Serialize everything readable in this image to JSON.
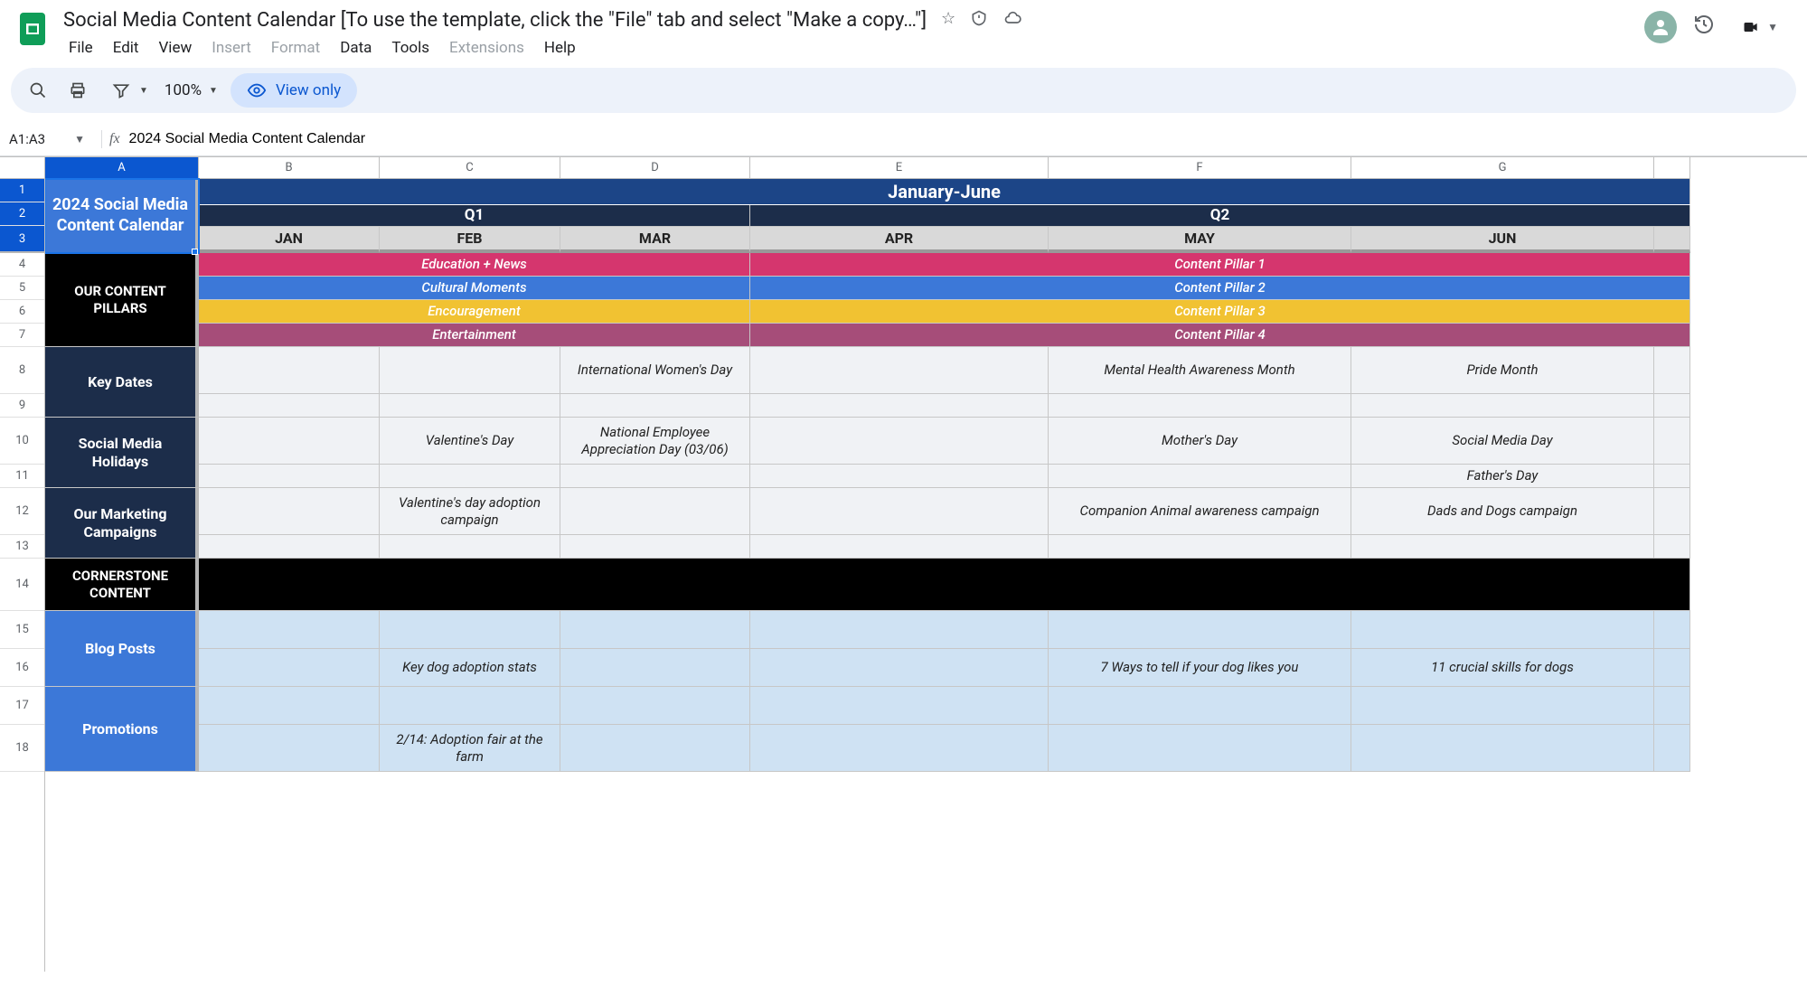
{
  "header": {
    "doc_title": "Social Media Content Calendar [To use the template, click the \"File\" tab and select \"Make a copy…\"]"
  },
  "menubar": {
    "file": "File",
    "edit": "Edit",
    "view": "View",
    "insert": "Insert",
    "format": "Format",
    "data": "Data",
    "tools": "Tools",
    "extensions": "Extensions",
    "help": "Help"
  },
  "toolbar": {
    "zoom": "100%",
    "view_only": "View only"
  },
  "formula": {
    "name_box": "A1:A3",
    "value": "2024 Social Media Content Calendar"
  },
  "columns": [
    "A",
    "B",
    "C",
    "D",
    "E",
    "F",
    "G"
  ],
  "rows": [
    "1",
    "2",
    "3",
    "4",
    "5",
    "6",
    "7",
    "8",
    "9",
    "10",
    "11",
    "12",
    "13",
    "14",
    "15",
    "16",
    "17",
    "18"
  ],
  "sheet": {
    "title": "2024 Social Media Content Calendar",
    "period": "January-June",
    "q1": "Q1",
    "q2": "Q2",
    "months": {
      "jan": "JAN",
      "feb": "FEB",
      "mar": "MAR",
      "apr": "APR",
      "may": "MAY",
      "jun": "JUN"
    },
    "side": {
      "pillars": "OUR CONTENT PILLARS",
      "keydates": "Key Dates",
      "holidays": "Social Media Holidays",
      "campaigns": "Our Marketing Campaigns",
      "cornerstone": "CORNERSTONE CONTENT",
      "blog": "Blog Posts",
      "promotions": "Promotions"
    },
    "pillars_q1": {
      "p1": "Education + News",
      "p2": "Cultural Moments",
      "p3": "Encouragement",
      "p4": "Entertainment"
    },
    "pillars_q2": {
      "p1": "Content Pillar 1",
      "p2": "Content Pillar 2",
      "p3": "Content Pillar 3",
      "p4": "Content Pillar 4"
    },
    "keydates": {
      "mar": "International Women's Day",
      "may": "Mental Health Awareness Month",
      "jun": "Pride Month"
    },
    "holidays": {
      "feb": "Valentine's Day",
      "mar": "National Employee Appreciation Day (03/06)",
      "may": "Mother's Day",
      "jun10": "Social Media Day",
      "jun11": "Father's Day"
    },
    "campaigns": {
      "feb": "Valentine's day adoption campaign",
      "may": "Companion Animal awareness campaign",
      "jun": "Dads and Dogs campaign"
    },
    "blog": {
      "feb": "Key dog adoption stats",
      "may": "7 Ways to tell if your dog likes you",
      "jun": "11 crucial skills for dogs"
    },
    "promo": {
      "feb": "2/14: Adoption fair at the farm"
    }
  }
}
